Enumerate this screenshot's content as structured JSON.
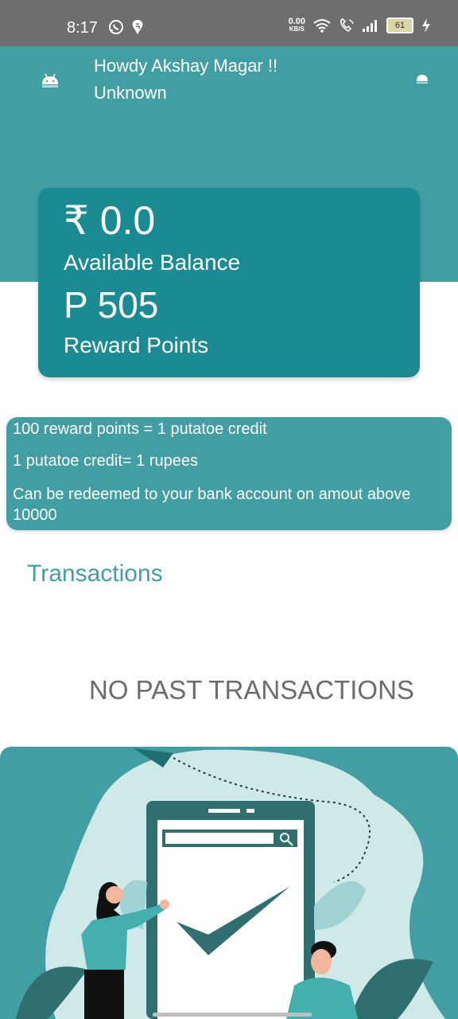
{
  "status_bar": {
    "time": "8:17",
    "net_speed_value": "0.00",
    "net_speed_unit": "KB/S",
    "battery": "61",
    "icons": [
      "whatsapp-icon",
      "swiggy-icon",
      "wifi-icon",
      "call-icon",
      "signal-icon",
      "battery-icon",
      "charging-icon"
    ]
  },
  "header": {
    "greeting": "Howdy Akshay Magar !!",
    "subtitle": "Unknown",
    "bg_color": "#419fa4"
  },
  "balance_card": {
    "balance": "₹ 0.0",
    "balance_label": "Available Balance",
    "points": "P 505",
    "points_label": "Reward Points",
    "bg_color": "#1a8a93"
  },
  "info": {
    "line1": "100 reward points = 1 putatoe credit",
    "line2": "1 putatoe credit= 1 rupees",
    "line3": "Can be redeemed to your bank account on amout above 10000"
  },
  "transactions": {
    "title": "Transactions",
    "empty_message": "NO PAST TRANSACTIONS"
  }
}
